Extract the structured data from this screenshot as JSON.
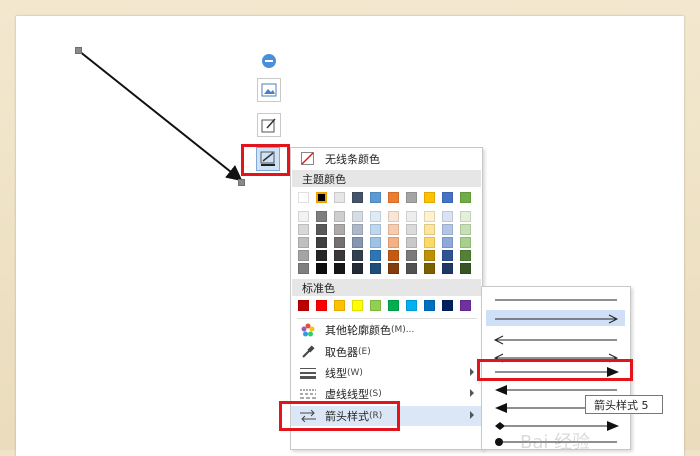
{
  "menu": {
    "no_line_color": "无线条颜色",
    "theme_colors_header": "主题颜色",
    "standard_colors_header": "标准色",
    "more_colors": "其他轮廓颜色",
    "more_colors_shortcut": "(M)...",
    "eyedropper": "取色器",
    "eyedropper_shortcut": "(E)",
    "line_type": "线型",
    "line_type_shortcut": "(W)",
    "dash_type": "虚线线型",
    "dash_type_shortcut": "(S)",
    "arrow_style": "箭头样式",
    "arrow_style_shortcut": "(R)"
  },
  "theme_top_row": [
    "#ffffff",
    "#000000",
    "#e7e6e6",
    "#44546a",
    "#5b9bd5",
    "#ed7d31",
    "#a5a5a5",
    "#ffc000",
    "#4472c4",
    "#70ad47"
  ],
  "theme_shades": [
    [
      "#f2f2f2",
      "#7f7f7f",
      "#d0cece",
      "#d6dce4",
      "#deebf6",
      "#fbe5d5",
      "#ededed",
      "#fff2cc",
      "#dae3f3",
      "#e2efd9"
    ],
    [
      "#d8d8d8",
      "#595959",
      "#aeaaaa",
      "#adb9ca",
      "#bdd7ee",
      "#f7cbac",
      "#dbdbdb",
      "#fee599",
      "#b4c6e7",
      "#c5e0b3"
    ],
    [
      "#bfbfbf",
      "#3f3f3f",
      "#757070",
      "#8496b0",
      "#9dc3e6",
      "#f4b183",
      "#c9c9c9",
      "#ffd965",
      "#8eaadb",
      "#a8d08d"
    ],
    [
      "#a5a5a5",
      "#262626",
      "#3a3838",
      "#323f4f",
      "#2e75b5",
      "#c55a11",
      "#7b7b7b",
      "#bf9000",
      "#2f5496",
      "#538135"
    ],
    [
      "#7f7f7f",
      "#0c0c0c",
      "#171616",
      "#222a35",
      "#1e4e79",
      "#833c0b",
      "#525252",
      "#7f6000",
      "#1f3864",
      "#375623"
    ]
  ],
  "standard_colors": [
    "#c00000",
    "#ff0000",
    "#ffc000",
    "#ffff00",
    "#92d050",
    "#00b050",
    "#00b0f0",
    "#0070c0",
    "#002060",
    "#7030a0"
  ],
  "tooltip": "箭头样式 5",
  "watermark": "Bai 经验",
  "icons": {
    "minus": "minus-circle-icon",
    "image": "image-icon",
    "edit": "shape-edit-icon",
    "outline": "shape-outline-icon"
  },
  "accent_colors": {
    "highlight": "#cfe3f7",
    "red_box": "#e3141b"
  }
}
